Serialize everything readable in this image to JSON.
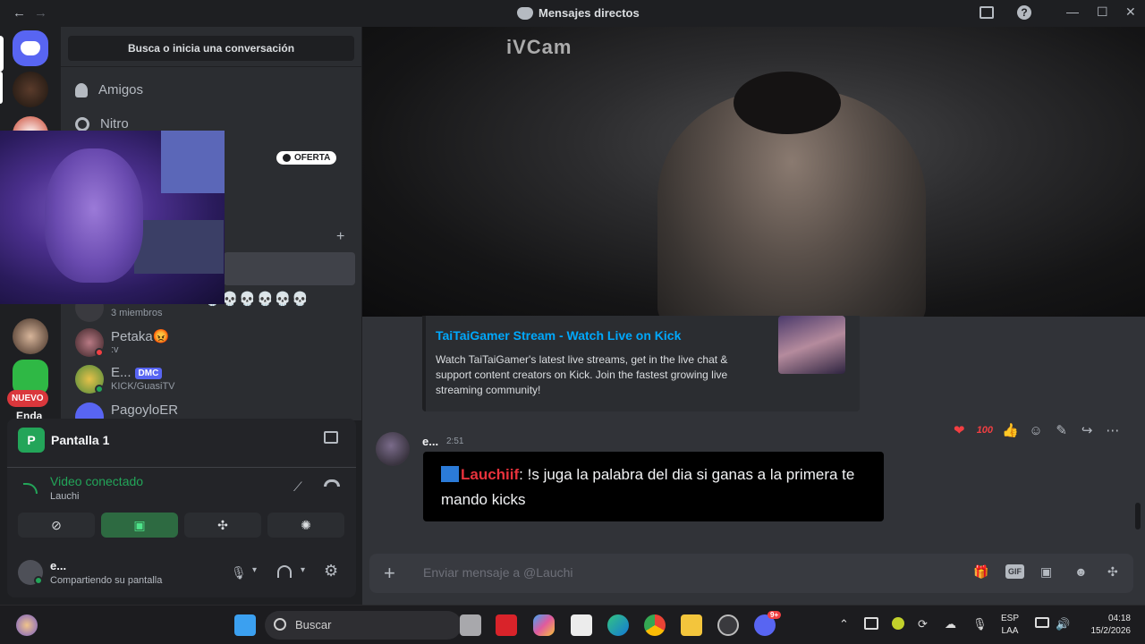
{
  "window": {
    "title": "Mensajes directos",
    "back": "←",
    "forward": "→",
    "inbox_icon": "inbox-icon",
    "help": "?",
    "minimize": "—",
    "maximize": "☐",
    "close": "✕"
  },
  "sidebar": {
    "search": "Busca o inicia una conversación",
    "nav": [
      {
        "label": "Amigos",
        "icon": "friends-icon"
      },
      {
        "label": "Nitro",
        "icon": "nitro-icon"
      }
    ],
    "offer_badge": "OFERTA",
    "add": "+",
    "skull_row": "💀💀💀💀💀💀",
    "dms": [
      {
        "name": "",
        "sub": "3 miembros"
      },
      {
        "name": "Petaka😡",
        "sub": ":v"
      },
      {
        "name": "E...",
        "tag": "DMC",
        "sub": "KICK/GuasiTV"
      },
      {
        "name": "PagoyloER",
        "sub": ""
      }
    ],
    "new_badge": "NUEVO",
    "cut_label": "Enda"
  },
  "voice_panel": {
    "title": "Pantalla 1",
    "status": "Video conectado",
    "user_in_call": "Lauchi",
    "me": {
      "name": "e...",
      "status": "Compartiendo su pantalla"
    }
  },
  "stream": {
    "overlay_text": "iVCam"
  },
  "embed": {
    "title": "TaiTaiGamer Stream - Watch Live on Kick",
    "description": "Watch TaiTaiGamer's latest live streams, get in the live chat & support content creators on Kick. Join the fastest growing live streaming community!"
  },
  "message": {
    "author": "e...",
    "time": "2:51",
    "mention": "Lauchiif",
    "text": ": !s juga la palabra del dia si ganas a la primera te mando kicks"
  },
  "reactions": {
    "heart": "❤",
    "hundred": "100",
    "thumbs": "👍"
  },
  "composer": {
    "placeholder": "Enviar mensaje a @Lauchi",
    "plus": "+",
    "gif": "GIF"
  },
  "taskbar": {
    "search_label": "Buscar",
    "lang_top": "ESP",
    "lang_bottom": "LAA",
    "time": "04:18",
    "date": "15/2/2026",
    "badge_9": "9+"
  },
  "colors": {
    "accent": "#5865f2",
    "green": "#23a559",
    "link": "#00a8fc",
    "mention": "#e8323c"
  }
}
